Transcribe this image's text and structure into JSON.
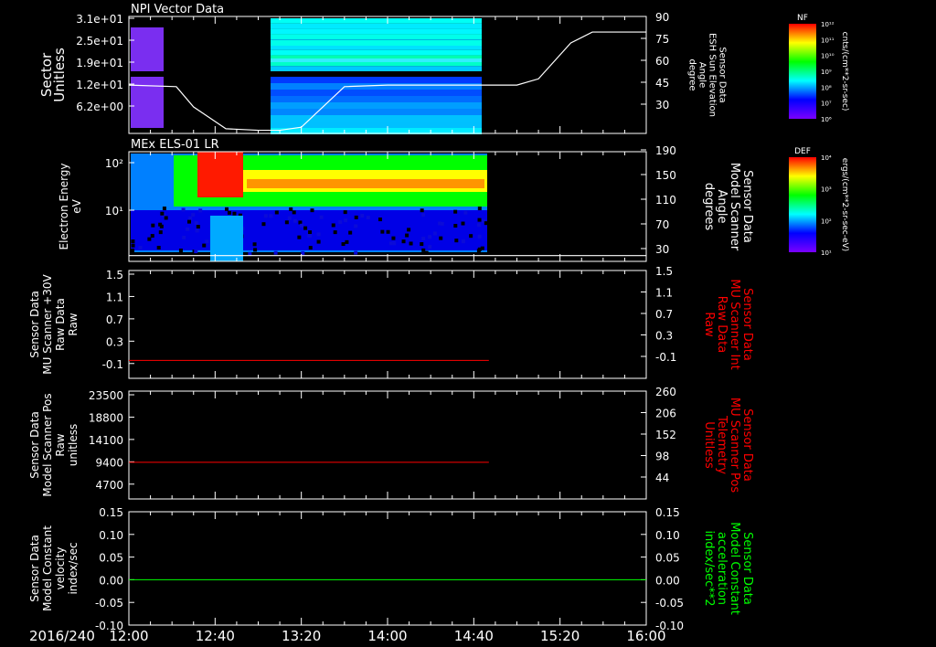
{
  "date_label": "2016/240",
  "time_ticks": [
    "12:00",
    "12:40",
    "13:20",
    "14:00",
    "14:40",
    "15:20",
    "16:00"
  ],
  "colors": {
    "white": "#ffffff",
    "red": "#ff0000",
    "green": "#00ff00"
  },
  "chart_data": [
    {
      "type": "heatmap",
      "title": "NPI Vector Data",
      "ylabel_left": [
        "Sector",
        "Unitless"
      ],
      "yticks_left": [
        "3.1e+01",
        "2.5e+01",
        "1.9e+01",
        "1.2e+01",
        "6.2e+00"
      ],
      "ylabel_right": [
        "Sensor Data",
        "ESH Sun Elevation",
        "Angle",
        "degree"
      ],
      "yticks_right": [
        "90",
        "75",
        "60",
        "45",
        "30"
      ],
      "ylim_right": [
        15,
        90
      ],
      "overlay_line": {
        "x": [
          "12:00",
          "12:22",
          "12:30",
          "12:45",
          "13:00",
          "13:10",
          "13:20",
          "13:40",
          "14:00",
          "14:40",
          "15:00",
          "15:10",
          "15:25",
          "15:35",
          "16:00"
        ],
        "y": [
          46,
          45,
          32,
          18,
          17,
          17,
          19,
          45,
          46,
          46,
          46,
          50,
          73,
          80,
          80
        ]
      },
      "colorbar": {
        "label": "NF",
        "units": "cnts/(cm**2-sr-sec)",
        "ticks": [
          "10¹²",
          "10¹¹",
          "10¹⁰",
          "10⁹",
          "10⁸",
          "10⁷",
          "10⁶"
        ]
      }
    },
    {
      "type": "heatmap",
      "title": "MEx ELS-01 LR",
      "ylabel_left": [
        "Electron Energy",
        "eV"
      ],
      "yticks_left": [
        "10²",
        "10¹"
      ],
      "ylabel_right": [
        "Sensor Data",
        "Model Scanner",
        "Angle",
        "degrees"
      ],
      "yticks_right": [
        "190",
        "150",
        "110",
        "70",
        "30"
      ],
      "ylim_right": [
        0,
        190
      ],
      "overlay_line": {
        "x": [
          "12:00",
          "16:00"
        ],
        "y": [
          10,
          10
        ]
      },
      "colorbar": {
        "label": "DEF",
        "units": "ergs/(cm**2-sr-sec-eV)",
        "ticks": [
          "10⁴",
          "10³",
          "10²",
          "10¹"
        ]
      }
    },
    {
      "type": "line",
      "ylabel_left": [
        "Sensor Data",
        "MU Scanner +30V",
        "Raw Data",
        "Raw"
      ],
      "yticks_left": [
        "1.5",
        "1.1",
        "0.7",
        "0.3",
        "-0.1"
      ],
      "ylabel_right": [
        "Sensor Data",
        "MU Scanner Int",
        "Raw Data",
        "Raw"
      ],
      "yticks_right": [
        "1.5",
        "1.1",
        "0.7",
        "0.3",
        "-0.1"
      ],
      "ylim": [
        -0.3,
        1.5
      ],
      "series": [
        {
          "x": [
            "12:00",
            "14:47"
          ],
          "y": [
            0.0,
            0.0
          ]
        }
      ]
    },
    {
      "type": "line",
      "ylabel_left": [
        "Sensor Data",
        "Model Scanner Pos",
        "Raw",
        "unitless"
      ],
      "yticks_left": [
        "23500",
        "18800",
        "14100",
        "9400",
        "4700"
      ],
      "ylabel_right": [
        "Sensor Data",
        "MU Scanner Pos",
        "Telemetry",
        "Unitless"
      ],
      "yticks_right": [
        "260",
        "206",
        "152",
        "98",
        "44"
      ],
      "ylim": [
        0,
        23500
      ],
      "series": [
        {
          "x": [
            "12:00",
            "14:47"
          ],
          "y": [
            8000,
            8000
          ]
        }
      ]
    },
    {
      "type": "line",
      "ylabel_left": [
        "Sensor Data",
        "Model Constant",
        "velocity",
        "index/sec"
      ],
      "yticks_left": [
        "0.15",
        "0.10",
        "0.05",
        "0.00",
        "-0.05",
        "-0.10"
      ],
      "ylabel_right": [
        "Sensor Data",
        "Model Constant",
        "acceleration",
        "index/sec**2"
      ],
      "yticks_right": [
        "0.15",
        "0.10",
        "0.05",
        "0.00",
        "-0.05",
        "-0.10"
      ],
      "ylim": [
        -0.1,
        0.15
      ],
      "series": [
        {
          "x": [
            "12:00",
            "16:00"
          ],
          "y": [
            0.0,
            0.0
          ]
        }
      ]
    }
  ]
}
